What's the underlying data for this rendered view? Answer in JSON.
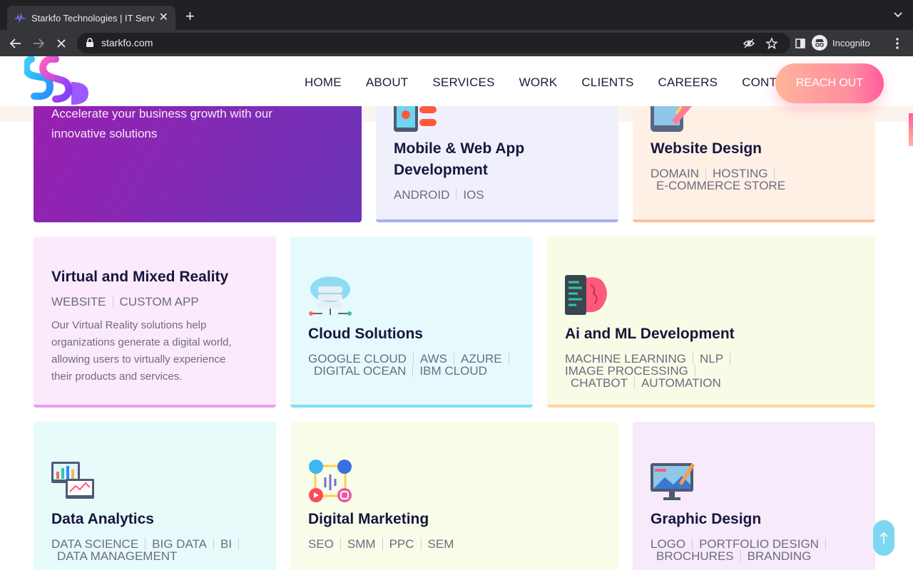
{
  "browser": {
    "tab_title": "Starkfo Technologies | IT Servi",
    "url": "starkfo.com",
    "profile": "Incognito"
  },
  "nav": {
    "items": [
      "HOME",
      "ABOUT",
      "SERVICES",
      "WORK",
      "CLIENTS",
      "CAREERS",
      "CONTACT"
    ],
    "cta": "REACH OUT"
  },
  "hero_card": {
    "text_line1": "Accelerate your business growth with our",
    "text_line2": "innovative solutions"
  },
  "services": [
    {
      "title": "Mobile & Web App Development",
      "title_l1": "Mobile & Web App",
      "title_l2": "Development",
      "tags": [
        "ANDROID",
        "IOS"
      ],
      "icon": "mobile-app-icon"
    },
    {
      "title": "Website Design",
      "tags": [
        "DOMAIN",
        "HOSTING",
        "E-COMMERCE STORE"
      ],
      "icon": "website-design-icon"
    },
    {
      "title": "Virtual and Mixed Reality",
      "tags": [
        "WEBSITE",
        "CUSTOM APP"
      ],
      "description": "Our Virtual Reality solutions help organizations generate a digital world, allowing users to virtually experience their products and services.",
      "desc_lines": [
        "Our Virtual Reality solutions help",
        "organizations generate a digital world,",
        "allowing users to virtually experience",
        "their products and services."
      ]
    },
    {
      "title": "Cloud Solutions",
      "tags": [
        "GOOGLE CLOUD",
        "AWS",
        "AZURE",
        "DIGITAL OCEAN",
        "IBM CLOUD"
      ],
      "icon": "cloud-server-icon"
    },
    {
      "title": "Ai and ML Development",
      "tags": [
        "MACHINE LEARNING",
        "NLP",
        "IMAGE PROCESSING",
        "CHATBOT",
        "AUTOMATION"
      ],
      "icon": "ai-brain-icon"
    },
    {
      "title": "Data Analytics",
      "tags": [
        "DATA SCIENCE",
        "BIG DATA",
        "BI",
        "DATA MANAGEMENT"
      ],
      "icon": "data-analytics-icon"
    },
    {
      "title": "Digital Marketing",
      "tags": [
        "SEO",
        "SMM",
        "PPC",
        "SEM"
      ],
      "icon": "social-media-icon"
    },
    {
      "title": "Graphic Design",
      "tags": [
        "LOGO",
        "PORTFOLIO DESIGN",
        "BROCHURES",
        "BRANDING"
      ],
      "icon": "graphic-design-icon"
    }
  ],
  "colors": {
    "hero_gradient_start": "#9b1fb0",
    "hero_gradient_end": "#6a35b8",
    "title": "#17163d",
    "accent_pink": "#ff5c9a"
  }
}
